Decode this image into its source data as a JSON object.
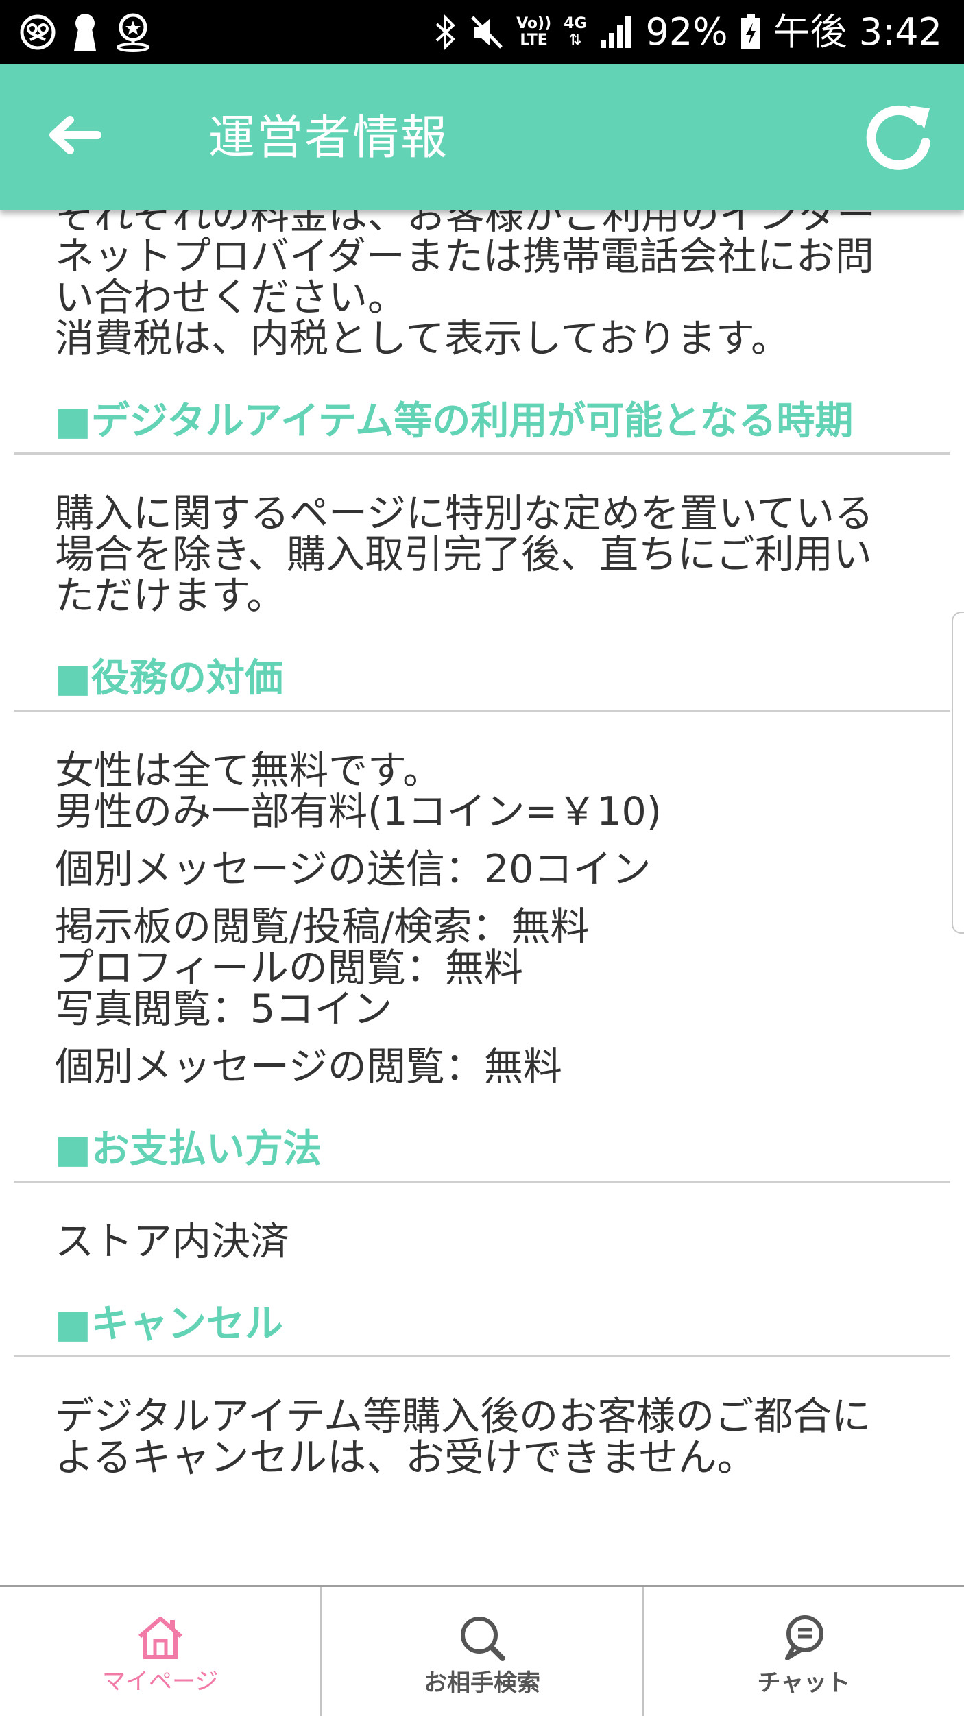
{
  "status_bar": {
    "battery": "92%",
    "time": "午後 3:42",
    "volte_top": "Vo))",
    "volte_bottom": "LTE",
    "network": "4G"
  },
  "app_bar": {
    "title": "運営者情報",
    "back_icon": "arrow-left-icon",
    "reload_icon": "reload-icon",
    "color": "#63d3b6"
  },
  "content": {
    "intro_lines": [
      "それぞれの料金は、お客様がご利用のインター",
      "ネットプロバイダーまたは携帯電話会社にお問",
      "い合わせください。",
      "消費税は、内税として表示しております。"
    ],
    "sections": [
      {
        "title": "■デジタルアイテム等の利用が可能となる時期",
        "paragraphs": [
          [
            "購入に関するページに特別な定めを置いている",
            "場合を除き、購入取引完了後、直ちにご利用い",
            "ただけます。"
          ]
        ]
      },
      {
        "title": "■役務の対価",
        "paragraphs": [
          [
            "女性は全て無料です。",
            "男性のみ一部有料(1コイン=￥10)"
          ],
          [
            "個別メッセージの送信：20コイン"
          ],
          [
            "掲示板の閲覧/投稿/検索：無料",
            "プロフィールの閲覧：無料",
            "写真閲覧：5コイン"
          ],
          [
            "個別メッセージの閲覧：無料"
          ]
        ]
      },
      {
        "title": "■お支払い方法",
        "paragraphs": [
          [
            "ストア内決済"
          ]
        ]
      },
      {
        "title": "■キャンセル",
        "paragraphs": [
          [
            "デジタルアイテム等購入後のお客様のご都合に",
            "よるキャンセルは、お受けできません。"
          ]
        ]
      }
    ],
    "accent_color": "#63d3b6"
  },
  "tab_bar": {
    "tabs": [
      {
        "label": "マイページ",
        "icon": "home-icon",
        "active": true
      },
      {
        "label": "お相手検索",
        "icon": "search-icon",
        "active": false
      },
      {
        "label": "チャット",
        "icon": "chat-icon",
        "active": false
      }
    ],
    "active_color": "#f27aa7",
    "inactive_color": "#555555"
  }
}
